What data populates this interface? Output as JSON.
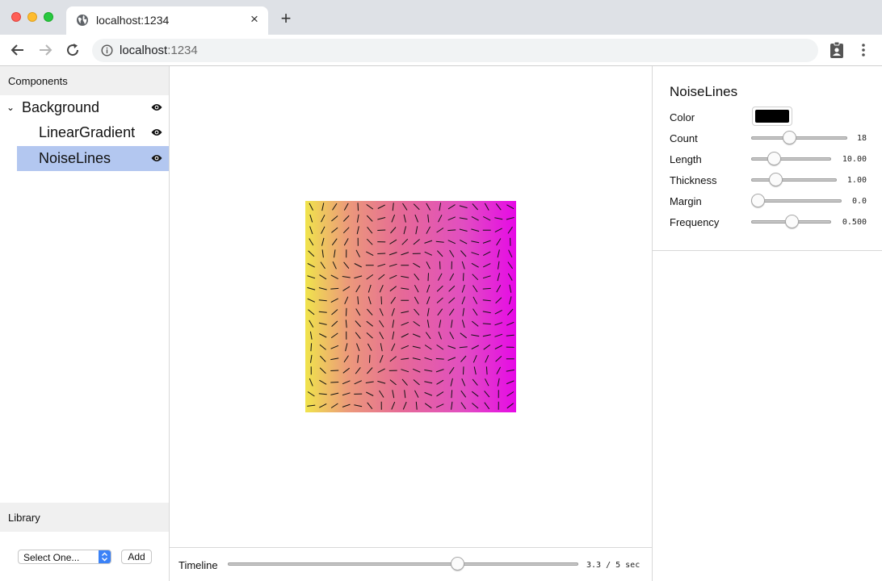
{
  "browser": {
    "tab_title": "localhost:1234",
    "tab_close": "×",
    "new_tab": "+",
    "url_host": "localhost",
    "url_port": ":1234"
  },
  "left_panel": {
    "components_header": "Components",
    "tree": [
      {
        "label": "Background",
        "expanded": true,
        "visible": true,
        "selected": false
      },
      {
        "label": "LinearGradient",
        "visible": true,
        "selected": false
      },
      {
        "label": "NoiseLines",
        "visible": true,
        "selected": true
      }
    ],
    "expand_chevron": "⌄",
    "library_header": "Library",
    "library_select": "Select One...",
    "add_button": "Add"
  },
  "timeline": {
    "label": "Timeline",
    "value_text": "3.3 / 5 sec",
    "current": 3.3,
    "max": 5
  },
  "inspector": {
    "title": "NoiseLines",
    "color_label": "Color",
    "color_value": "#000000",
    "properties": [
      {
        "label": "Count",
        "value": "18",
        "fraction": 0.38
      },
      {
        "label": "Length",
        "value": "10.00",
        "fraction": 0.24
      },
      {
        "label": "Thickness",
        "value": "1.00",
        "fraction": 0.24
      },
      {
        "label": "Margin",
        "value": "0.0",
        "fraction": 0.0
      },
      {
        "label": "Frequency",
        "value": "0.500",
        "fraction": 0.5
      }
    ]
  },
  "colors": {
    "selection": "#b3c7f0",
    "gradient_start": "#f0e44c",
    "gradient_end": "#e60ae6",
    "accent": "#3b82f7"
  }
}
